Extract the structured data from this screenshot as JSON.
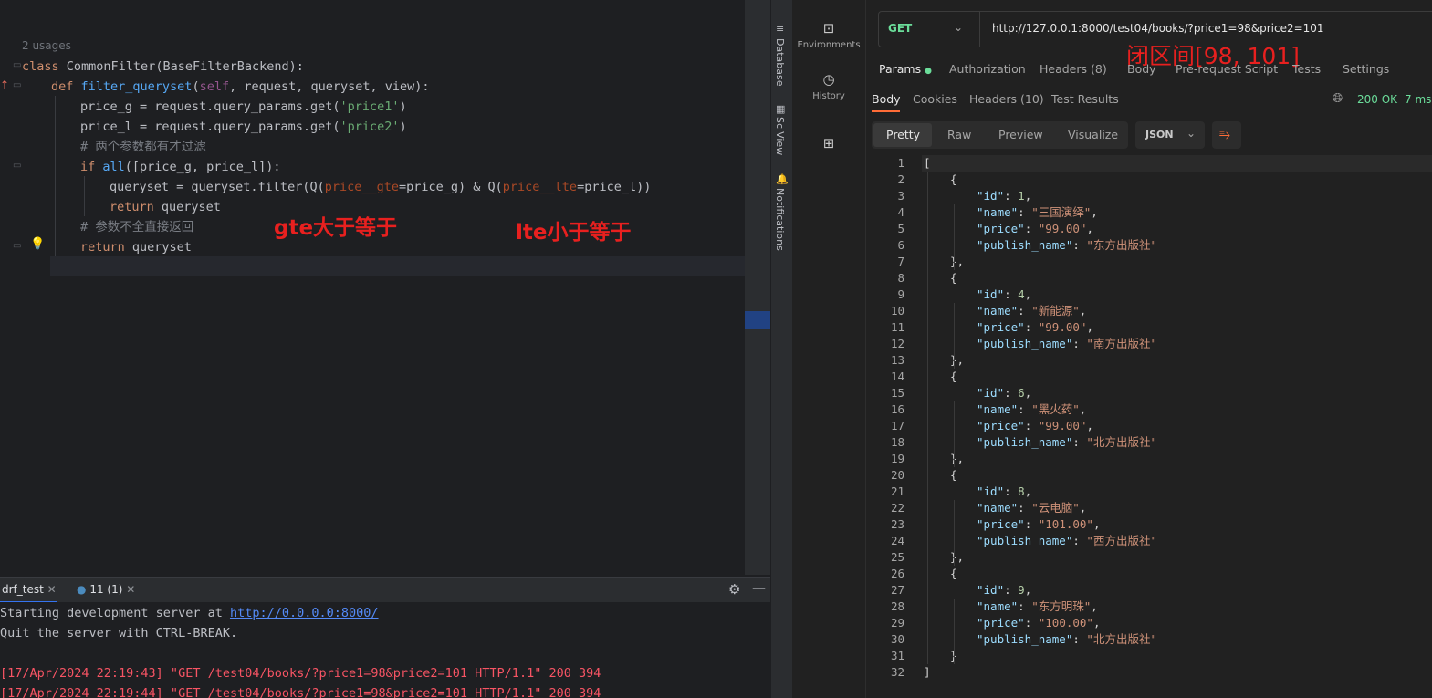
{
  "ide": {
    "usages": "2 usages",
    "code": [
      {
        "parts": [
          [
            "kw",
            "class "
          ],
          [
            "",
            "CommonFilter(BaseFilterBackend):"
          ]
        ]
      },
      {
        "parts": [
          [
            "kw",
            "def "
          ],
          [
            "fn",
            "filter_queryset"
          ],
          [
            "",
            "("
          ],
          [
            "self",
            "self"
          ],
          [
            "",
            ", request, queryset, view):"
          ]
        ]
      },
      {
        "parts": [
          [
            "",
            "price_g = request.query_params.get("
          ],
          [
            "str",
            "'price1'"
          ],
          [
            "",
            ")"
          ]
        ]
      },
      {
        "parts": [
          [
            "",
            "price_l = request.query_params.get("
          ],
          [
            "str",
            "'price2'"
          ],
          [
            "",
            ")"
          ]
        ]
      },
      {
        "parts": [
          [
            "cmt",
            "# 两个参数都有才过滤"
          ]
        ]
      },
      {
        "parts": [
          [
            "kw",
            "if "
          ],
          [
            "fn",
            "all"
          ],
          [
            "",
            "([price_g, price_l]):"
          ]
        ]
      },
      {
        "parts": [
          [
            "",
            "queryset = queryset.filter(Q("
          ],
          [
            "param",
            "price__gte"
          ],
          [
            "",
            "=price_g) & Q("
          ],
          [
            "param",
            "price__lte"
          ],
          [
            "",
            "=price_l))"
          ]
        ]
      },
      {
        "parts": [
          [
            "kw",
            "return "
          ],
          [
            "",
            "queryset"
          ]
        ]
      },
      {
        "parts": [
          [
            "cmt",
            "# 参数不全直接返回"
          ]
        ]
      },
      {
        "parts": [
          [
            "kw",
            "return "
          ],
          [
            "",
            "queryset"
          ]
        ]
      }
    ],
    "annotations": {
      "gte": "gte大于等于",
      "lte": "lte小于等于"
    },
    "tool_tabs": {
      "database": "Database",
      "sciview": "SciView",
      "notifications": "Notifications"
    },
    "console_tabs": {
      "run": "drf_test",
      "python": "11 (1)"
    },
    "console": {
      "line1_prefix": "Starting development server at ",
      "line1_link": "http://0.0.0.0:8000/",
      "line2": "Quit the server with CTRL-BREAK.",
      "log1": "[17/Apr/2024 22:19:43] \"GET /test04/books/?price1=98&price2=101 HTTP/1.1\" 200 394",
      "log2": "[17/Apr/2024 22:19:44] \"GET /test04/books/?price1=98&price2=101 HTTP/1.1\" 200 394"
    },
    "colors": {
      "log": "#f75464",
      "link": "#548af7"
    }
  },
  "postman": {
    "sidebar": {
      "environments": "Environments",
      "history": "History"
    },
    "method": "GET",
    "url": "http://127.0.0.1:8000/test04/books/?price1=98&price2=101",
    "annotation": "闭区间[98, 101]",
    "request_tabs": {
      "params": "Params",
      "authorization": "Authorization",
      "headers": "Headers (8)",
      "body": "Body",
      "prerequest": "Pre-request Script",
      "tests": "Tests",
      "settings": "Settings"
    },
    "response_tabs": {
      "body": "Body",
      "cookies": "Cookies",
      "headers": "Headers (10)",
      "test_results": "Test Results"
    },
    "status": "200 OK",
    "time": "7 ms",
    "view_modes": {
      "pretty": "Pretty",
      "raw": "Raw",
      "preview": "Preview",
      "visualize": "Visualize"
    },
    "format": "JSON",
    "books": [
      {
        "id": "1",
        "name": "三国演绎",
        "price": "99.00",
        "publish_name": "东方出版社"
      },
      {
        "id": "4",
        "name": "新能源",
        "price": "99.00",
        "publish_name": "南方出版社"
      },
      {
        "id": "6",
        "name": "黑火药",
        "price": "99.00",
        "publish_name": "北方出版社"
      },
      {
        "id": "8",
        "name": "云电脑",
        "price": "101.00",
        "publish_name": "西方出版社"
      },
      {
        "id": "9",
        "name": "东方明珠",
        "price": "100.00",
        "publish_name": "北方出版社"
      }
    ]
  }
}
